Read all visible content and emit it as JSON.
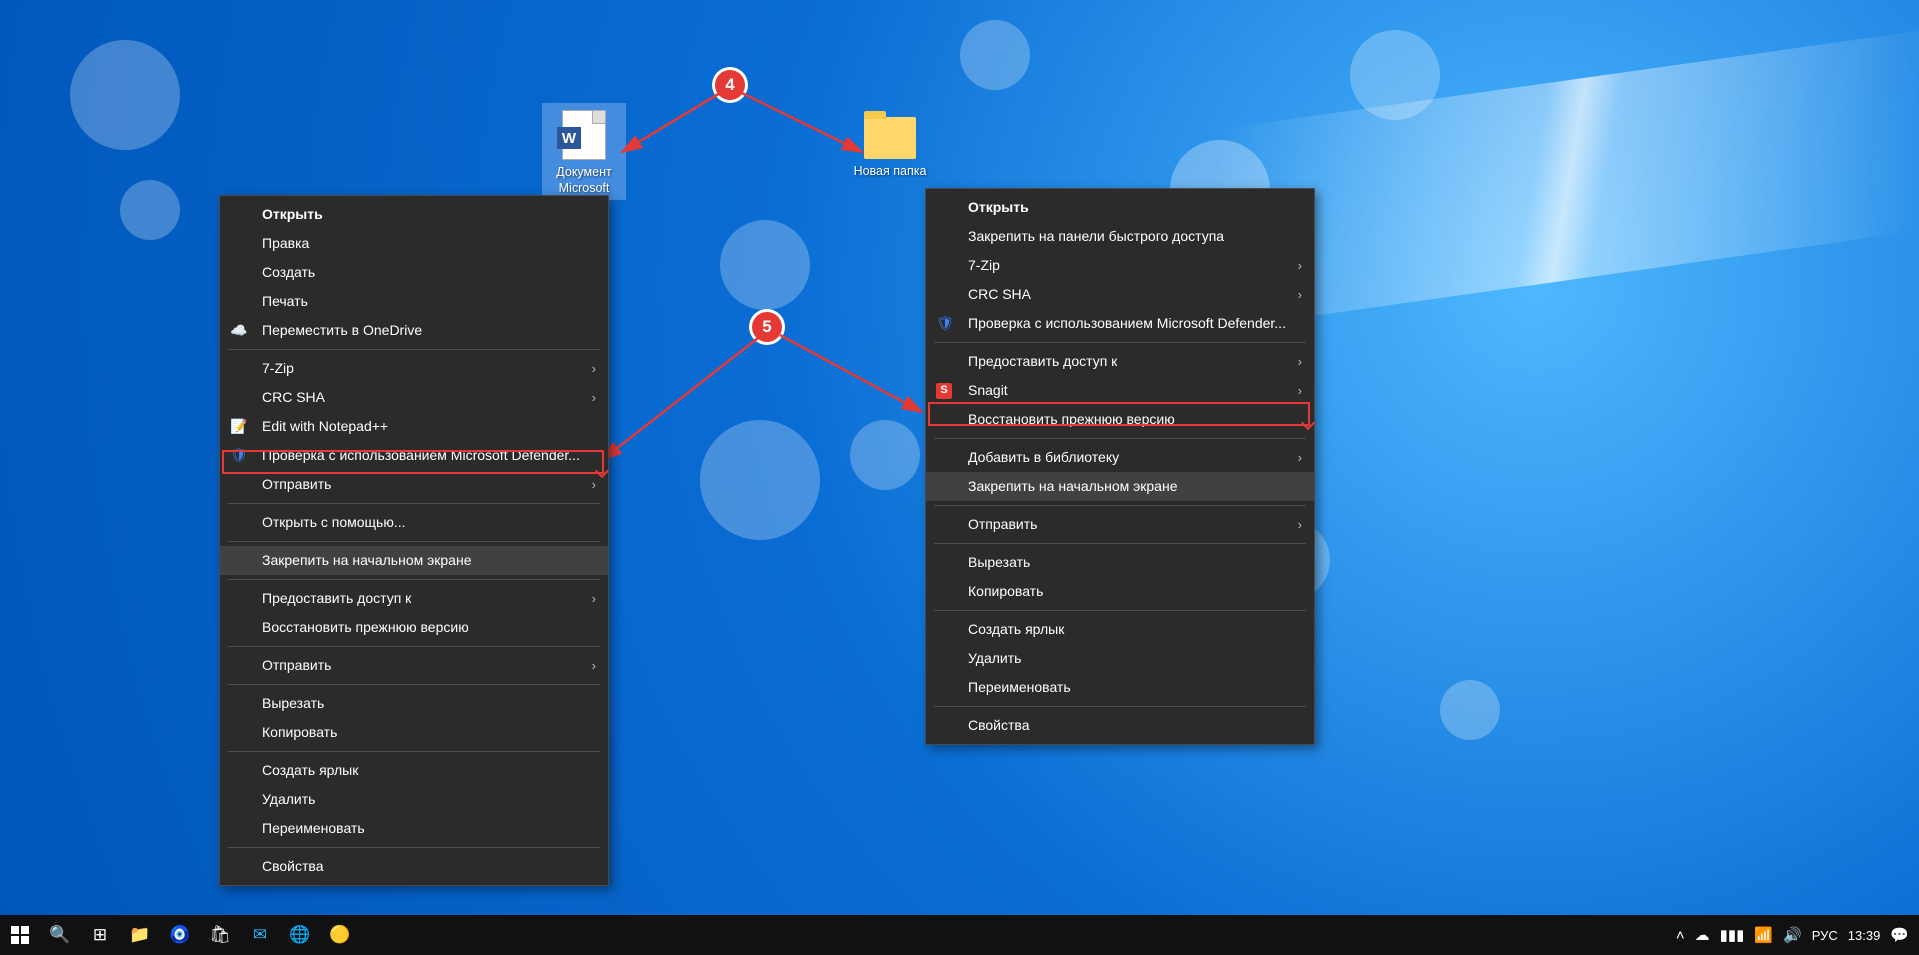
{
  "desktop": {
    "word_label": "Документ Microsoft",
    "folder_label": "Новая папка"
  },
  "annotations": {
    "badge4": "4",
    "badge5": "5"
  },
  "menu_left": {
    "open": "Открыть",
    "edit": "Правка",
    "create": "Создать",
    "print": "Печать",
    "onedrive": "Переместить в OneDrive",
    "sevenzip": "7-Zip",
    "crcsha": "CRC SHA",
    "notepadpp": "Edit with Notepad++",
    "defender": "Проверка с использованием Microsoft Defender...",
    "send": "Отправить",
    "openwith": "Открыть с помощью...",
    "pin_start": "Закрепить на начальном экране",
    "grant_access": "Предоставить доступ к",
    "restore_prev": "Восстановить прежнюю версию",
    "send2": "Отправить",
    "cut": "Вырезать",
    "copy": "Копировать",
    "shortcut": "Создать ярлык",
    "delete": "Удалить",
    "rename": "Переименовать",
    "properties": "Свойства"
  },
  "menu_right": {
    "open": "Открыть",
    "pin_quick": "Закрепить на панели быстрого доступа",
    "sevenzip": "7-Zip",
    "crcsha": "CRC SHA",
    "defender": "Проверка с использованием Microsoft Defender...",
    "grant_access": "Предоставить доступ к",
    "snagit": "Snagit",
    "restore_prev": "Восстановить прежнюю версию",
    "add_library": "Добавить в библиотеку",
    "pin_start": "Закрепить на начальном экране",
    "send": "Отправить",
    "cut": "Вырезать",
    "copy": "Копировать",
    "shortcut": "Создать ярлык",
    "delete": "Удалить",
    "rename": "Переименовать",
    "properties": "Свойства"
  },
  "taskbar": {
    "lang": "РУС",
    "time": "13:39"
  }
}
